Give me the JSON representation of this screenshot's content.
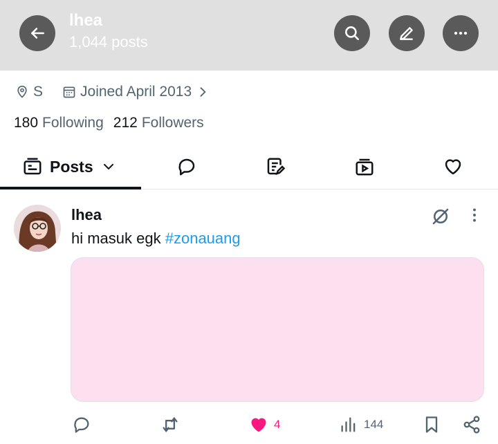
{
  "header": {
    "title": "lhea",
    "post_count": "1,044 posts"
  },
  "profile": {
    "location": "S",
    "joined": "Joined April 2013",
    "following_count": "180",
    "following_label": "Following",
    "followers_count": "212",
    "followers_label": "Followers"
  },
  "tabs": {
    "posts_label": "Posts"
  },
  "post": {
    "author": "lhea",
    "text": "hi masuk egk ",
    "hashtag": "#zonauang",
    "likes": "4",
    "views": "144",
    "media_color": "#fce0ef"
  },
  "colors": {
    "accent": "#1d9bf0",
    "like": "#f91880",
    "header_bg": "#e0e0e0"
  }
}
